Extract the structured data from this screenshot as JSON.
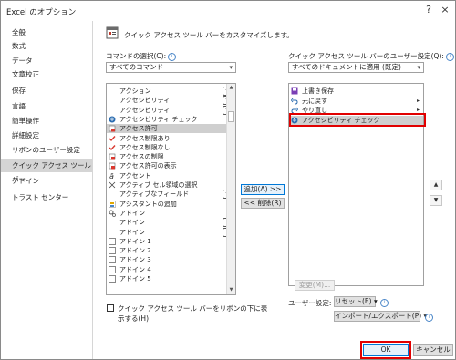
{
  "window": {
    "title": "Excel のオプション",
    "help_glyph": "?",
    "close_glyph": "×"
  },
  "sidebar": {
    "items": [
      {
        "label": "全般",
        "selected": false
      },
      {
        "label": "数式",
        "selected": false
      },
      {
        "label": "データ",
        "selected": false
      },
      {
        "label": "文章校正",
        "selected": false
      },
      {
        "label": "保存",
        "selected": false
      },
      {
        "label": "言語",
        "selected": false
      },
      {
        "label": "簡単操作",
        "selected": false
      },
      {
        "label": "詳細設定",
        "selected": false
      },
      {
        "label": "リボンのユーザー設定",
        "selected": false
      },
      {
        "label": "クイック アクセス ツール バー",
        "selected": true
      },
      {
        "label": "アドイン",
        "selected": false
      },
      {
        "label": "トラスト センター",
        "selected": false
      }
    ]
  },
  "header": {
    "title": "クイック アクセス ツール バーをカスタマイズします。"
  },
  "commands": {
    "label": "コマンドの選択(C):",
    "selected": "すべてのコマンド",
    "items": [
      {
        "label": "アクション",
        "icon": "",
        "suffix": "button"
      },
      {
        "label": "アクセシビリティ",
        "icon": "",
        "suffix": "button"
      },
      {
        "label": "アクセシビリティ",
        "icon": "",
        "suffix": "button"
      },
      {
        "label": "アクセシビリティ チェック",
        "icon": "accessibility-check",
        "suffix": ""
      },
      {
        "label": "アクセス許可",
        "icon": "lock-red",
        "suffix": "",
        "selected": true
      },
      {
        "label": "アクセス制限あり",
        "icon": "check",
        "suffix": ""
      },
      {
        "label": "アクセス制限なし",
        "icon": "check",
        "suffix": ""
      },
      {
        "label": "アクセスの制限",
        "icon": "lock-red",
        "suffix": "arrow"
      },
      {
        "label": "アクセス許可の表示",
        "icon": "lock-red",
        "suffix": ""
      },
      {
        "label": "アクセント",
        "icon": "accent",
        "suffix": "arrow"
      },
      {
        "label": "アクティブ セル領域の選択",
        "icon": "cross",
        "suffix": ""
      },
      {
        "label": "アクティブなフィールド",
        "icon": "",
        "suffix": "button"
      },
      {
        "label": "アシスタントの追加",
        "icon": "assist",
        "suffix": ""
      },
      {
        "label": "アドイン",
        "icon": "gear",
        "suffix": ""
      },
      {
        "label": "アドイン",
        "icon": "",
        "suffix": "button"
      },
      {
        "label": "アドイン",
        "icon": "",
        "suffix": "button"
      },
      {
        "label": "アドイン 1",
        "icon": "square",
        "suffix": ""
      },
      {
        "label": "アドイン 2",
        "icon": "square",
        "suffix": ""
      },
      {
        "label": "アドイン 3",
        "icon": "square",
        "suffix": ""
      },
      {
        "label": "アドイン 4",
        "icon": "square",
        "suffix": ""
      },
      {
        "label": "アドイン 5",
        "icon": "square",
        "suffix": ""
      }
    ]
  },
  "qat": {
    "label": "クイック アクセス ツール バーのユーザー設定(Q):",
    "selected": "すべてのドキュメントに適用 (既定)",
    "items": [
      {
        "label": "上書き保存",
        "icon": "save",
        "suffix": ""
      },
      {
        "label": "元に戻す",
        "icon": "undo",
        "suffix": "arrow"
      },
      {
        "label": "やり直し",
        "icon": "redo",
        "suffix": "arrow"
      },
      {
        "label": "アクセシビリティ チェック",
        "icon": "accessibility-check",
        "suffix": "",
        "selected": true
      }
    ]
  },
  "buttons": {
    "add": "追加(A) >>",
    "remove": "<< 削除(R)",
    "modify": "変更(M)...",
    "reset": "リセット(E) ▾",
    "import_export": "インポート/エクスポート(P) ▾",
    "ok": "OK",
    "cancel": "キャンセル",
    "move_up": "▲",
    "move_down": "▼"
  },
  "checkbox": {
    "line1": "クイック アクセス ツール バーをリボンの下に表",
    "line2": "示する(H)",
    "checked": false
  },
  "user_settings_label": "ユーザー設定:",
  "info_glyph": "i",
  "colors": {
    "highlight_red": "#e10000",
    "selected_bg": "#cfcfcf",
    "accent_blue": "#0078d7"
  }
}
